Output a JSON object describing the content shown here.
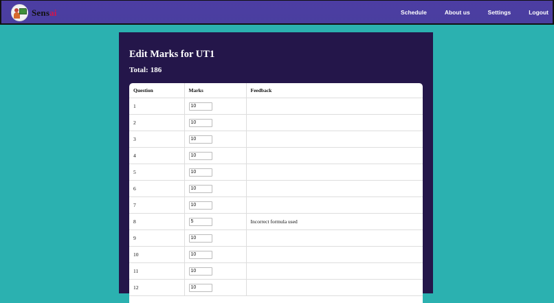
{
  "brand": {
    "name_main": "Sens",
    "name_accent": "ai"
  },
  "nav": {
    "links": [
      "Schedule",
      "About us",
      "Settings",
      "Logout"
    ]
  },
  "page": {
    "title": "Edit Marks for UT1",
    "total_label": "Total:",
    "total_value": "186"
  },
  "table": {
    "headers": [
      "Question",
      "Marks",
      "Feedback"
    ],
    "rows": [
      {
        "question": "1",
        "marks": "10",
        "feedback": ""
      },
      {
        "question": "2",
        "marks": "10",
        "feedback": ""
      },
      {
        "question": "3",
        "marks": "10",
        "feedback": ""
      },
      {
        "question": "4",
        "marks": "10",
        "feedback": ""
      },
      {
        "question": "5",
        "marks": "10",
        "feedback": ""
      },
      {
        "question": "6",
        "marks": "10",
        "feedback": ""
      },
      {
        "question": "7",
        "marks": "10",
        "feedback": ""
      },
      {
        "question": "8",
        "marks": "5",
        "feedback": "Incorrect formula used"
      },
      {
        "question": "9",
        "marks": "10",
        "feedback": ""
      },
      {
        "question": "10",
        "marks": "10",
        "feedback": ""
      },
      {
        "question": "11",
        "marks": "10",
        "feedback": ""
      },
      {
        "question": "12",
        "marks": "10",
        "feedback": ""
      }
    ]
  },
  "colors": {
    "background": "#2bb1b0",
    "navbar": "#4a3f9f",
    "card": "#24164a",
    "brand_accent": "#d4144a"
  }
}
